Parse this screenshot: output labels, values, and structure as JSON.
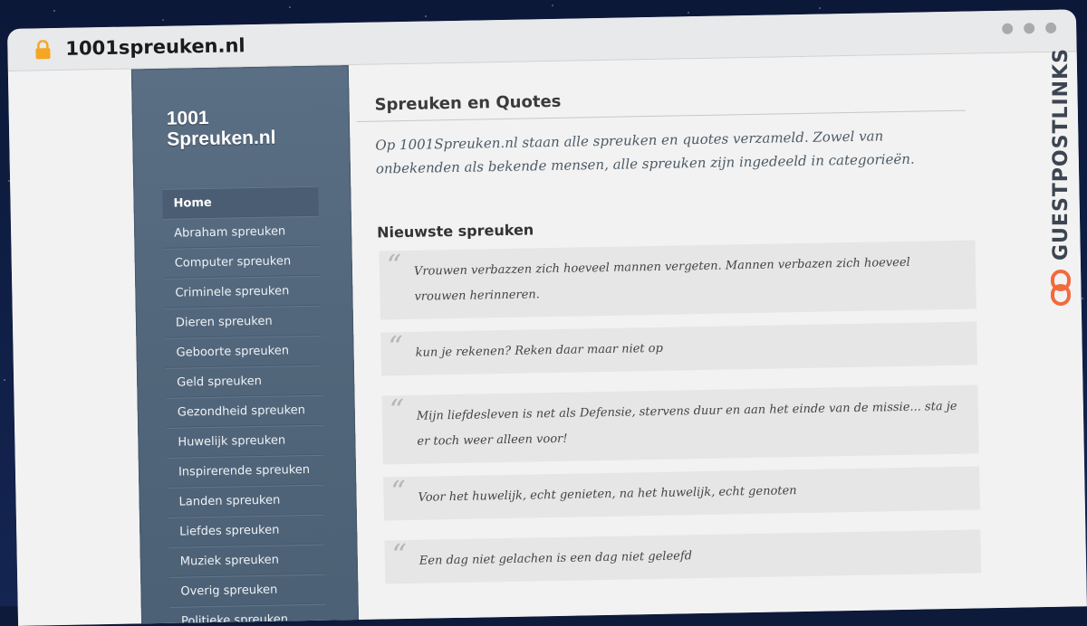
{
  "browser": {
    "url": "1001spreuken.nl"
  },
  "site": {
    "logo_line1": "1001",
    "logo_line2": "Spreuken.nl"
  },
  "nav": [
    {
      "label": "Home",
      "active": true
    },
    {
      "label": "Abraham spreuken"
    },
    {
      "label": "Computer spreuken"
    },
    {
      "label": "Criminele spreuken"
    },
    {
      "label": "Dieren spreuken"
    },
    {
      "label": "Geboorte spreuken"
    },
    {
      "label": "Geld spreuken"
    },
    {
      "label": "Gezondheid spreuken"
    },
    {
      "label": "Huwelijk spreuken"
    },
    {
      "label": "Inspirerende spreuken"
    },
    {
      "label": "Landen spreuken"
    },
    {
      "label": "Liefdes spreuken"
    },
    {
      "label": "Muziek spreuken"
    },
    {
      "label": "Overig spreuken"
    },
    {
      "label": "Politieke spreuken"
    }
  ],
  "main": {
    "title": "Spreuken en Quotes",
    "intro": "Op 1001Spreuken.nl staan alle spreuken en quotes verzameld. Zowel van onbekenden als bekende mensen, alle spreuken zijn ingedeeld in categorieën.",
    "latest_heading": "Nieuwste spreuken",
    "quotes": [
      "Vrouwen verbazzen zich hoeveel mannen vergeten. Mannen verbazen zich hoeveel vrouwen herinneren.",
      "kun je rekenen? Reken daar maar niet op",
      "Mijn liefdesleven is net als Defensie, stervens duur en aan het einde van de missie... sta je er toch weer alleen voor!",
      "Voor het huwelijk, echt genieten, na het huwelijk, echt genoten",
      "Een dag niet gelachen is een dag niet geleefd"
    ]
  },
  "watermark": {
    "text": "GUESTPOSTLINKS",
    "color": "#f26a3d"
  },
  "colors": {
    "sidebar": "#52667b",
    "page_bg": "#f2f2f2",
    "quote_bg": "#e6e6e6"
  }
}
